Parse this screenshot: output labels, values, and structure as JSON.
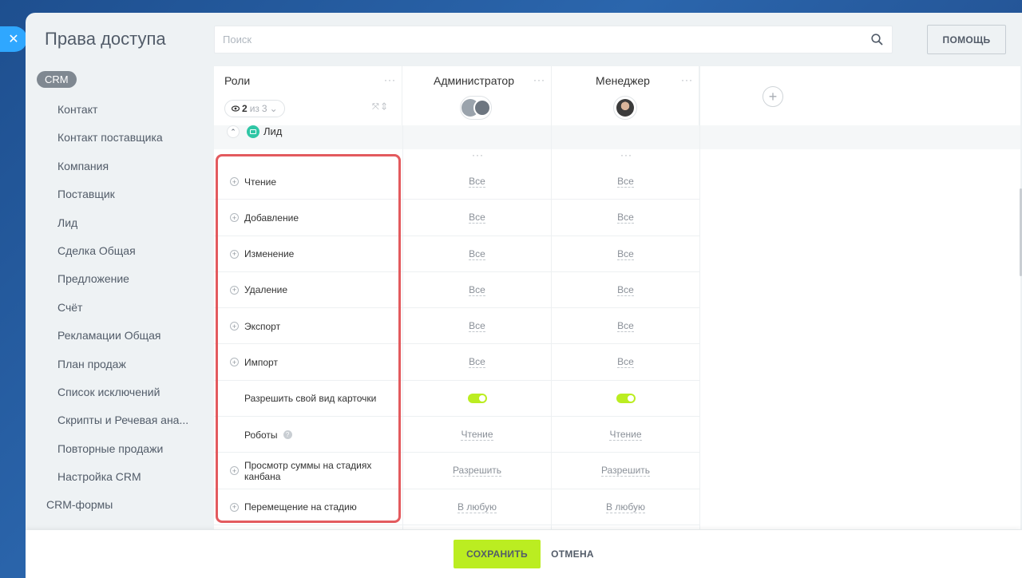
{
  "page": {
    "title": "Права доступа",
    "help_label": "ПОМОЩЬ"
  },
  "search": {
    "placeholder": "Поиск",
    "icon": "search-icon"
  },
  "sidebar": {
    "group_label": "CRM",
    "items": [
      "Контакт",
      "Контакт поставщика",
      "Компания",
      "Поставщик",
      "Лид",
      "Сделка Общая",
      "Предложение",
      "Счёт",
      "Рекламации Общая",
      "План продаж",
      "Список исключений",
      "Скрипты и Речевая ана...",
      "Повторные продажи",
      "Настройка CRM"
    ],
    "forms_label": "CRM-формы"
  },
  "table": {
    "roles_header": "Роли",
    "visible_count": "2",
    "count_sep": "из",
    "total_count": "3",
    "columns": [
      {
        "name": "Администратор"
      },
      {
        "name": "Менеджер"
      }
    ],
    "section_label": "Лид",
    "rows": [
      {
        "label": "Чтение",
        "expandable": true,
        "admin": "Все",
        "manager": "Все"
      },
      {
        "label": "Добавление",
        "expandable": true,
        "admin": "Все",
        "manager": "Все"
      },
      {
        "label": "Изменение",
        "expandable": true,
        "admin": "Все",
        "manager": "Все"
      },
      {
        "label": "Удаление",
        "expandable": true,
        "admin": "Все",
        "manager": "Все"
      },
      {
        "label": "Экспорт",
        "expandable": true,
        "admin": "Все",
        "manager": "Все"
      },
      {
        "label": "Импорт",
        "expandable": true,
        "admin": "Все",
        "manager": "Все"
      },
      {
        "label": "Разрешить свой вид карточки",
        "expandable": false,
        "admin": "toggle-on",
        "manager": "toggle-on"
      },
      {
        "label": "Роботы",
        "expandable": false,
        "has_help": true,
        "admin": "Чтение",
        "manager": "Чтение"
      },
      {
        "label": "Просмотр суммы на стадиях канбана",
        "expandable": true,
        "admin": "Разрешить",
        "manager": "Разрешить"
      },
      {
        "label": "Перемещение на стадию",
        "expandable": true,
        "admin": "В любую",
        "manager": "В любую"
      }
    ]
  },
  "footer": {
    "save_label": "СОХРАНИТЬ",
    "cancel_label": "ОТМЕНА"
  },
  "colors": {
    "accent_green": "#bbed21",
    "highlight_red": "#e35a5e",
    "close_blue": "#2fa7ff"
  }
}
